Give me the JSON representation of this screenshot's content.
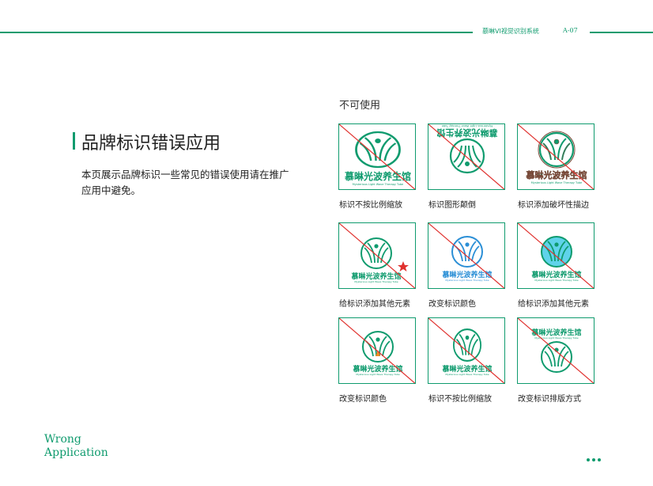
{
  "header": {
    "brand_system": "慕晽VI视觉识别系统",
    "page_number": "A-07"
  },
  "main": {
    "title": "品牌标识错误应用",
    "description": "本页展示品牌标识一些常见的错误使用请在推广应用中避免。"
  },
  "examples": {
    "section_label": "不可使用",
    "logo_text": "慕晽光波养生馆",
    "logo_subtext": "Mysterious Light Wave Therapy Tube",
    "items": [
      {
        "caption": "标识不按比例缩放"
      },
      {
        "caption": "标识图形颠倒"
      },
      {
        "caption": "标识添加破坏性描边"
      },
      {
        "caption": "给标识添加其他元素"
      },
      {
        "caption": "改变标识颜色"
      },
      {
        "caption": "给标识添加其他元素"
      },
      {
        "caption": "改变标识颜色"
      },
      {
        "caption": "标识不按比例缩放"
      },
      {
        "caption": "改变标识排版方式"
      }
    ]
  },
  "footer": {
    "line1": "Wrong",
    "line2": "Application"
  },
  "colors": {
    "brand_green": "#0f9b6e",
    "strike_red": "#e0312e",
    "alt_blue": "#2b8fd6",
    "fill_cyan": "#5fd3ea"
  }
}
